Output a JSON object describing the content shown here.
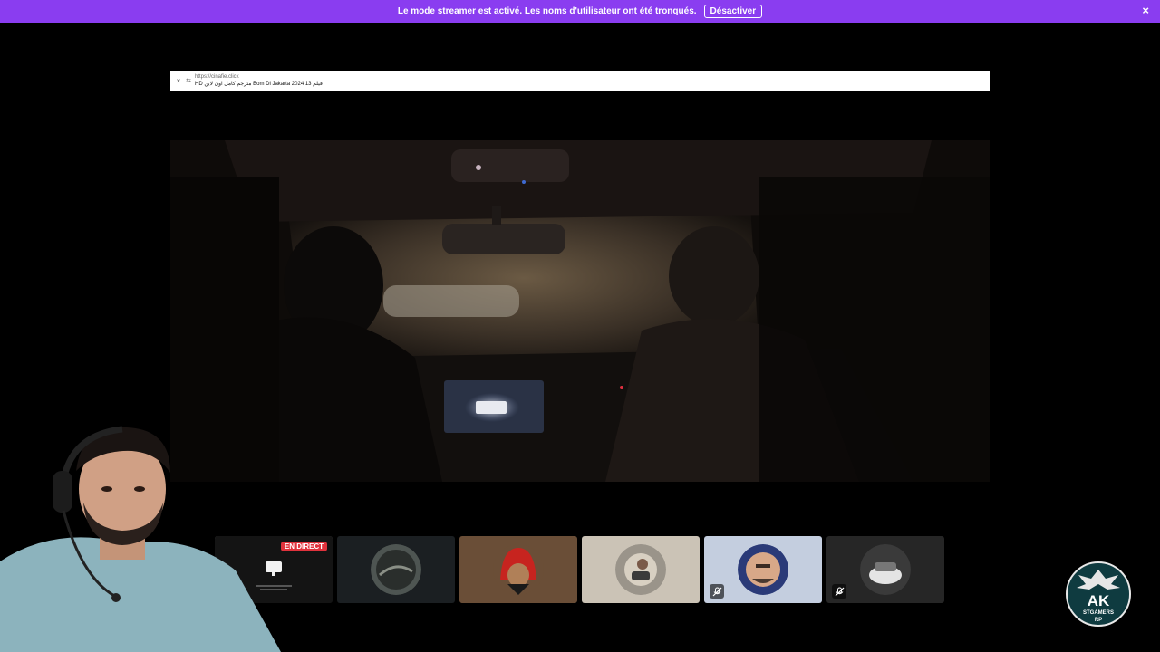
{
  "banner": {
    "message": "Le mode streamer est activé. Les noms d'utilisateur ont été tronqués.",
    "disable_label": "Désactiver",
    "close_icon": "×"
  },
  "browser": {
    "url": "https://cinafie.click",
    "page_title": "فيلم 13 Bom Di Jakarta 2024 مترجم كامل اون لاين HD",
    "close_icon": "×"
  },
  "participants": {
    "live_badge": "EN DIRECT",
    "tiles": [
      {
        "kind": "screen-share",
        "live": true
      },
      {
        "kind": "avatar",
        "style": "night-sky",
        "muted": false
      },
      {
        "kind": "avatar",
        "style": "red-hood",
        "muted": false
      },
      {
        "kind": "avatar",
        "style": "car-driver",
        "muted": false
      },
      {
        "kind": "avatar",
        "style": "shield-face",
        "muted": true
      },
      {
        "kind": "avatar",
        "style": "white-car",
        "muted": true
      }
    ]
  },
  "logo": {
    "text": "AK",
    "subtext": "STGAMERS",
    "tag": "RP"
  },
  "colors": {
    "banner": "#8a3df0",
    "live": "#e0323c",
    "background": "#000000"
  }
}
